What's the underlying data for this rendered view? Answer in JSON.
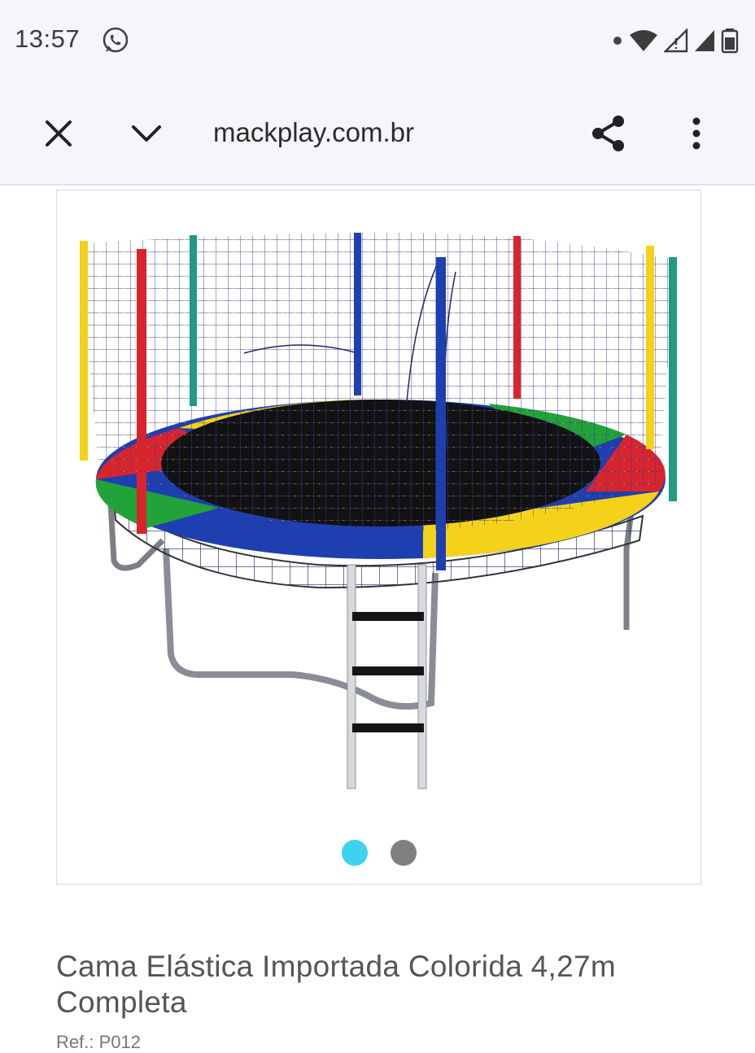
{
  "status_bar": {
    "time": "13:57",
    "notification_icon": "whatsapp-icon",
    "indicators": [
      "dot-icon",
      "wifi-icon",
      "signal-icon",
      "signal-icon",
      "battery-icon"
    ]
  },
  "toolbar": {
    "close_icon": "close-icon",
    "collapse_icon": "chevron-down-icon",
    "url": "mackplay.com.br",
    "share_icon": "share-icon",
    "menu_icon": "more-vert-icon"
  },
  "product": {
    "image": "trampoline-product-image",
    "carousel": {
      "count": 2,
      "active_index": 0,
      "active_color": "#3ed2f0",
      "inactive_color": "#808080"
    },
    "title": "Cama Elástica Importada Colorida 4,27m Completa",
    "ref_partial": "Ref.: P012"
  },
  "colors": {
    "bar_background": "#f7f4fa",
    "red": "#d8252d",
    "yellow": "#f4d21a",
    "green": "#22a33a",
    "blue": "#1e3fb0",
    "teal": "#1f9a83"
  }
}
